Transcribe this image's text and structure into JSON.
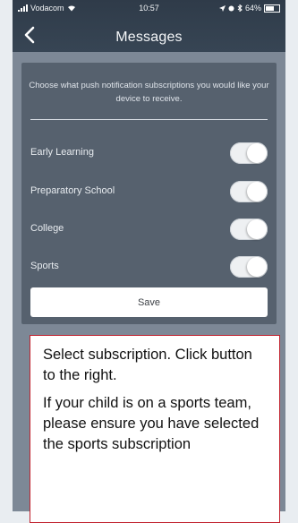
{
  "status_bar": {
    "carrier": "Vodacom",
    "time": "10:57",
    "battery": "64%"
  },
  "header": {
    "title": "Messages",
    "back_icon": "chevron-left-icon"
  },
  "panel": {
    "intro": "Choose what push notification subscriptions you would like your device to receive.",
    "subscriptions": [
      {
        "label": "Early Learning",
        "on": true
      },
      {
        "label": "Preparatory School",
        "on": true
      },
      {
        "label": "College",
        "on": true
      },
      {
        "label": "Sports",
        "on": true
      }
    ],
    "save_label": "Save"
  },
  "callout": {
    "line1": "Select subscription.  Click button to the right.",
    "line2": "If your child is on a sports team, please ensure you have selected the sports subscription"
  },
  "colors": {
    "topbar": "#2f3b49",
    "panel": "#56616e",
    "callout_border": "#c0202d"
  }
}
